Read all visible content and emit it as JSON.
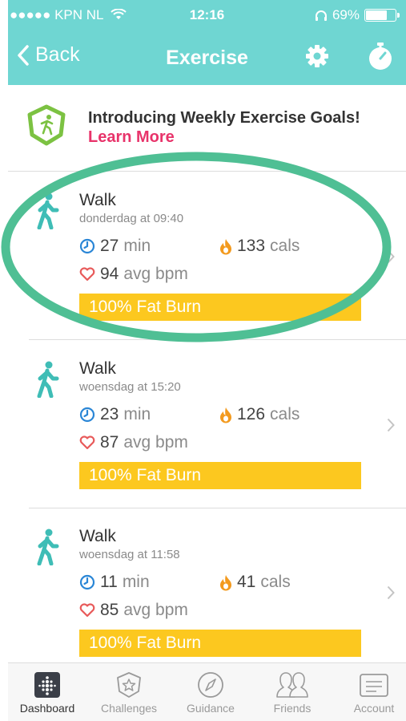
{
  "status_bar": {
    "carrier": "●●●●● KPN NL",
    "wifi_icon": "wifi-icon",
    "time": "12:16",
    "headphones_icon": "headphones-icon",
    "battery": "69%",
    "battery_level": 0.69
  },
  "nav": {
    "back_label": "Back",
    "title": "Exercise",
    "settings_icon": "gear-icon",
    "timer_icon": "stopwatch-icon"
  },
  "promo": {
    "title": "Introducing Weekly Exercise Goals!",
    "link": "Learn More"
  },
  "entries": [
    {
      "title": "Walk",
      "date": "donderdag at 09:40",
      "minutes": "27",
      "minutes_unit": "min",
      "calories": "133",
      "calories_unit": "cals",
      "bpm": "94",
      "bpm_unit": "avg bpm",
      "zone": "100% Fat Burn"
    },
    {
      "title": "Walk",
      "date": "woensdag at 15:20",
      "minutes": "23",
      "minutes_unit": "min",
      "calories": "126",
      "calories_unit": "cals",
      "bpm": "87",
      "bpm_unit": "avg bpm",
      "zone": "100% Fat Burn"
    },
    {
      "title": "Walk",
      "date": "woensdag at 11:58",
      "minutes": "11",
      "minutes_unit": "min",
      "calories": "41",
      "calories_unit": "cals",
      "bpm": "85",
      "bpm_unit": "avg bpm",
      "zone": "100% Fat Burn"
    }
  ],
  "tabs": [
    {
      "label": "Dashboard",
      "icon": "dashboard-icon",
      "active": true
    },
    {
      "label": "Challenges",
      "icon": "challenges-icon",
      "active": false
    },
    {
      "label": "Guidance",
      "icon": "compass-icon",
      "active": false
    },
    {
      "label": "Friends",
      "icon": "friends-icon",
      "active": false
    },
    {
      "label": "Account",
      "icon": "account-icon",
      "active": false
    }
  ],
  "colors": {
    "header": "#6fd6d2",
    "accent_link": "#e8336a",
    "fat_burn_bar": "#fcc81f",
    "teal": "#3fbdb6",
    "highlight_ellipse": "#4fbf94"
  }
}
